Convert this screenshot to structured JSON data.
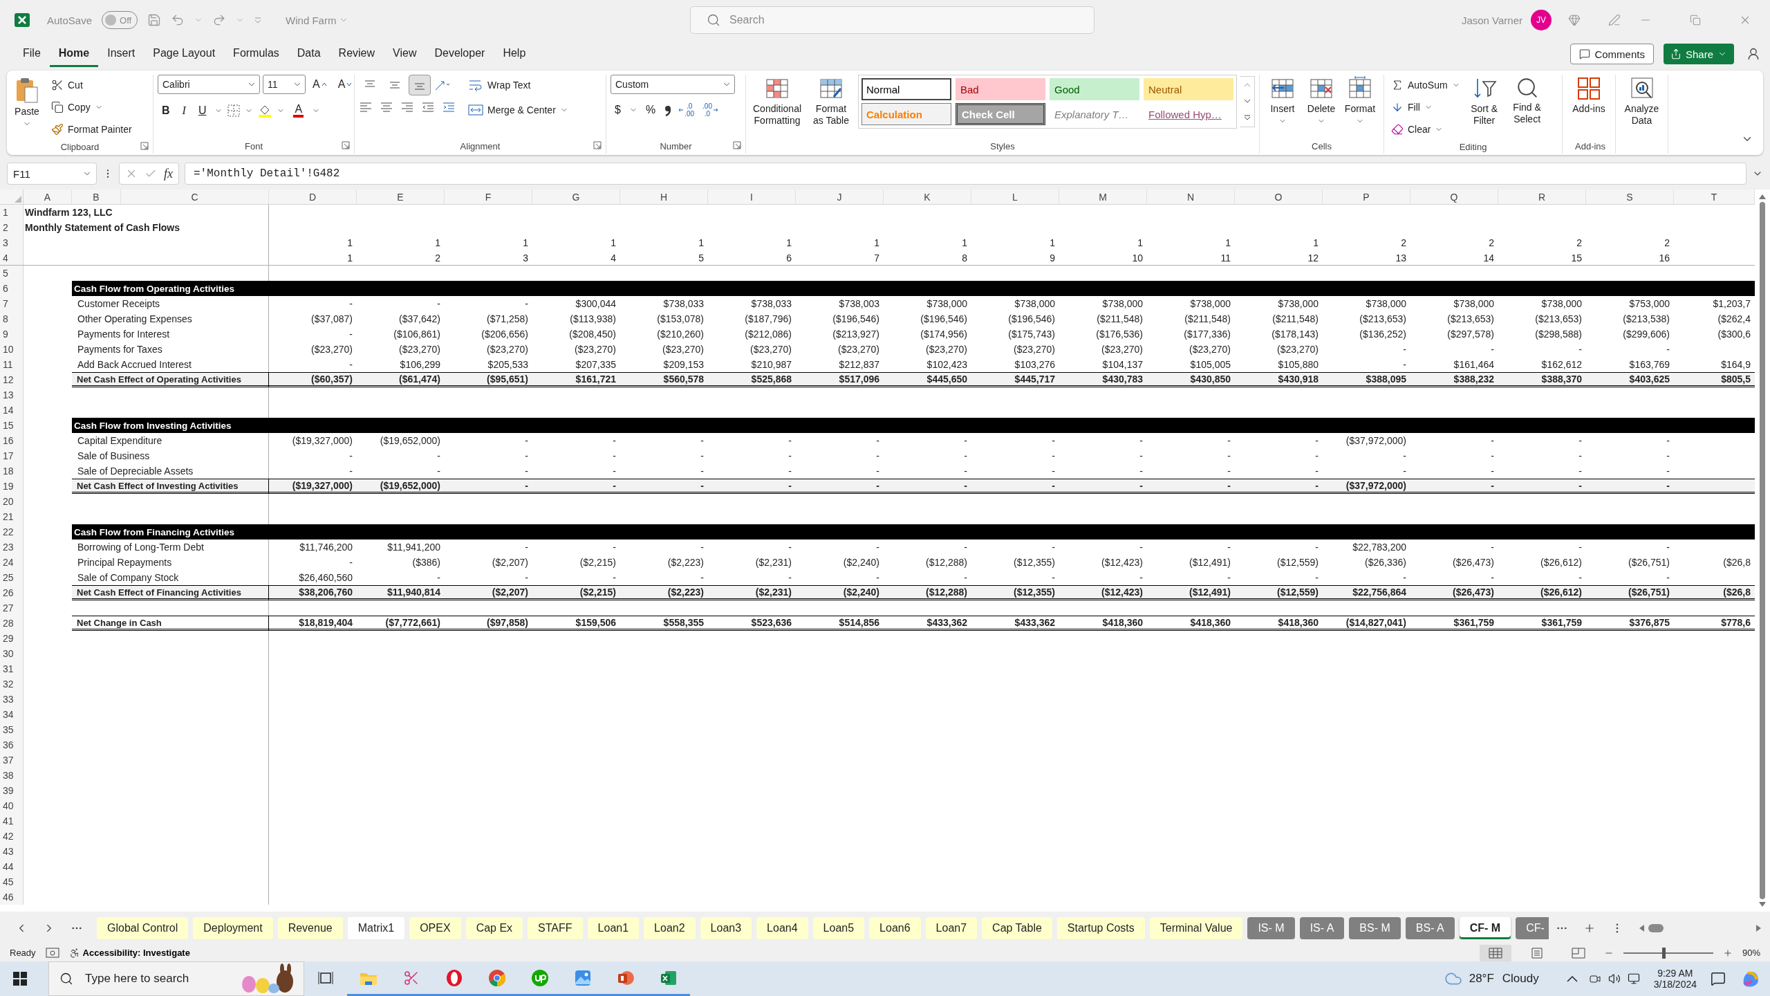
{
  "title_bar": {
    "autosave": "AutoSave",
    "autosave_on": false,
    "autosave_state": "Off",
    "file_name": "Wind Farm",
    "search": {
      "placeholder": "Search"
    },
    "user": "Jason Varner",
    "initials": "JV"
  },
  "menu_tabs": [
    {
      "label": "File",
      "selected": false
    },
    {
      "label": "Home",
      "selected": true
    },
    {
      "label": "Insert",
      "selected": false
    },
    {
      "label": "Page Layout",
      "selected": false
    },
    {
      "label": "Formulas",
      "selected": false
    },
    {
      "label": "Data",
      "selected": false
    },
    {
      "label": "Review",
      "selected": false
    },
    {
      "label": "View",
      "selected": false
    },
    {
      "label": "Developer",
      "selected": false
    },
    {
      "label": "Help",
      "selected": false
    }
  ],
  "header_actions": {
    "comments": "Comments",
    "share": "Share"
  },
  "ribbon": {
    "clipboard": {
      "label": "Clipboard",
      "paste": "Paste",
      "cut": "Cut",
      "copy": "Copy",
      "format_painter": "Format Painter"
    },
    "font": {
      "label": "Font",
      "name": "Calibri",
      "size": "11",
      "grow": "A",
      "shrink": "A",
      "bold": "B",
      "italic": "I",
      "underline": "U",
      "font_color": "A"
    },
    "alignment": {
      "label": "Alignment",
      "vertical_alignment": [
        {
          "selected": false
        },
        {
          "selected": false
        },
        {
          "selected": true
        }
      ],
      "wrap_text": "Wrap Text",
      "merge_center": "Merge & Center"
    },
    "number": {
      "label": "Number",
      "format": "Custom",
      "currency": "$",
      "percent": "%",
      "increase_decimal": [
        ".0",
        ".00"
      ],
      "decrease_decimal": [
        ".00",
        ".0"
      ]
    },
    "styles": {
      "label": "Styles",
      "conditional_formatting": "Conditional Formatting",
      "format_as_table": "Format as Table",
      "cell_styles": [
        {
          "label": "Normal",
          "kind": "normal",
          "selected": true
        },
        {
          "label": "Bad",
          "kind": "bad",
          "selected": false
        },
        {
          "label": "Good",
          "kind": "good",
          "selected": false
        },
        {
          "label": "Neutral",
          "kind": "neutral",
          "selected": false
        },
        {
          "label": "Calculation",
          "kind": "calculation",
          "selected": false
        },
        {
          "label": "Check Cell",
          "kind": "check",
          "selected": false
        },
        {
          "label": "Explanatory T…",
          "kind": "explanatory",
          "selected": false
        },
        {
          "label": "Followed Hyp…",
          "kind": "hyperlink",
          "selected": false
        }
      ]
    },
    "cells": {
      "label": "Cells",
      "buttons": [
        "Insert",
        "Delete",
        "Format"
      ]
    },
    "editing": {
      "label": "Editing",
      "autosum": "AutoSum",
      "fill": "Fill",
      "clear": "Clear",
      "sort_filter": "Sort & Filter",
      "find_select": "Find & Select"
    },
    "add_ins": {
      "label": "Add-ins",
      "button": "Add-ins"
    },
    "analyze": {
      "button": "Analyze Data"
    }
  },
  "formula_bar": {
    "name_box": "F11",
    "fx": "fx",
    "formula": "='Monthly Detail'!G482"
  },
  "sheet": {
    "columns": [
      "A",
      "B",
      "C",
      "D",
      "E",
      "F",
      "G",
      "H",
      "I",
      "J",
      "K",
      "L",
      "M",
      "N",
      "O",
      "P",
      "Q",
      "R",
      "S",
      "T"
    ],
    "rows": [
      {
        "number": "1",
        "kind": "title",
        "text": "Windfarm 123, LLC"
      },
      {
        "number": "2",
        "kind": "title",
        "text": "Monthly Statement of Cash Flows"
      },
      {
        "number": "3",
        "kind": "period",
        "values": [
          "1",
          "1",
          "1",
          "1",
          "1",
          "1",
          "1",
          "1",
          "1",
          "1",
          "1",
          "1",
          "2",
          "2",
          "2",
          "2"
        ]
      },
      {
        "number": "4",
        "kind": "period",
        "values": [
          "1",
          "2",
          "3",
          "4",
          "5",
          "6",
          "7",
          "8",
          "9",
          "10",
          "11",
          "12",
          "13",
          "14",
          "15",
          "16"
        ]
      },
      {
        "number": "5",
        "kind": "blank"
      },
      {
        "number": "6",
        "kind": "section",
        "label": "Cash Flow from Operating Activities"
      },
      {
        "number": "7",
        "kind": "item",
        "label": "Customer Receipts",
        "values": [
          "-",
          "-",
          "-",
          "$300,044",
          "$738,033",
          "$738,033",
          "$738,003",
          "$738,000",
          "$738,000",
          "$738,000",
          "$738,000",
          "$738,000",
          "$738,000",
          "$738,000",
          "$738,000",
          "$753,000",
          "$1,203,7"
        ]
      },
      {
        "number": "8",
        "kind": "item",
        "label": "Other Operating Expenses",
        "values": [
          "($37,087)",
          "($37,642)",
          "($71,258)",
          "($113,938)",
          "($153,078)",
          "($187,796)",
          "($196,546)",
          "($196,546)",
          "($196,546)",
          "($211,548)",
          "($211,548)",
          "($211,548)",
          "($213,653)",
          "($213,653)",
          "($213,653)",
          "($213,538)",
          "($262,4"
        ]
      },
      {
        "number": "9",
        "kind": "item",
        "label": "Payments for Interest",
        "values": [
          "-",
          "($106,861)",
          "($206,656)",
          "($208,450)",
          "($210,260)",
          "($212,086)",
          "($213,927)",
          "($174,956)",
          "($175,743)",
          "($176,536)",
          "($177,336)",
          "($178,143)",
          "($136,252)",
          "($297,578)",
          "($298,588)",
          "($299,606)",
          "($300,6"
        ]
      },
      {
        "number": "10",
        "kind": "item",
        "label": "Payments for Taxes",
        "values": [
          "($23,270)",
          "($23,270)",
          "($23,270)",
          "($23,270)",
          "($23,270)",
          "($23,270)",
          "($23,270)",
          "($23,270)",
          "($23,270)",
          "($23,270)",
          "($23,270)",
          "($23,270)",
          "-",
          "-",
          "-",
          "-"
        ]
      },
      {
        "number": "11",
        "kind": "item",
        "label": "Add Back Accrued Interest",
        "values": [
          "-",
          "$106,299",
          "$205,533",
          "$207,335",
          "$209,153",
          "$210,987",
          "$212,837",
          "$102,423",
          "$103,276",
          "$104,137",
          "$105,005",
          "$105,880",
          "-",
          "$161,464",
          "$162,612",
          "$163,769",
          "$164,9"
        ]
      },
      {
        "number": "12",
        "kind": "total",
        "label": "Net Cash Effect of Operating Activities",
        "values": [
          "($60,357)",
          "($61,474)",
          "($95,651)",
          "$161,721",
          "$560,578",
          "$525,868",
          "$517,096",
          "$445,650",
          "$445,717",
          "$430,783",
          "$430,850",
          "$430,918",
          "$388,095",
          "$388,232",
          "$388,370",
          "$403,625",
          "$805,5"
        ]
      },
      {
        "number": "13",
        "kind": "blank"
      },
      {
        "number": "14",
        "kind": "blank"
      },
      {
        "number": "15",
        "kind": "section",
        "label": "Cash Flow from Investing Activities"
      },
      {
        "number": "16",
        "kind": "item",
        "label": "Capital Expenditure",
        "values": [
          "($19,327,000)",
          "($19,652,000)",
          "-",
          "-",
          "-",
          "-",
          "-",
          "-",
          "-",
          "-",
          "-",
          "-",
          "($37,972,000)",
          "-",
          "-",
          "-"
        ]
      },
      {
        "number": "17",
        "kind": "item",
        "label": "Sale of Business",
        "values": [
          "-",
          "-",
          "-",
          "-",
          "-",
          "-",
          "-",
          "-",
          "-",
          "-",
          "-",
          "-",
          "-",
          "-",
          "-",
          "-"
        ]
      },
      {
        "number": "18",
        "kind": "item",
        "label": "Sale of Depreciable Assets",
        "values": [
          "-",
          "-",
          "-",
          "-",
          "-",
          "-",
          "-",
          "-",
          "-",
          "-",
          "-",
          "-",
          "-",
          "-",
          "-",
          "-"
        ]
      },
      {
        "number": "19",
        "kind": "total",
        "label": "Net Cash Effect of Investing Activities",
        "values": [
          "($19,327,000)",
          "($19,652,000)",
          "-",
          "-",
          "-",
          "-",
          "-",
          "-",
          "-",
          "-",
          "-",
          "-",
          "($37,972,000)",
          "-",
          "-",
          "-"
        ]
      },
      {
        "number": "20",
        "kind": "blank"
      },
      {
        "number": "21",
        "kind": "blank"
      },
      {
        "number": "22",
        "kind": "section",
        "label": "Cash Flow from Financing Activities"
      },
      {
        "number": "23",
        "kind": "item",
        "label": "Borrowing of Long-Term Debt",
        "values": [
          "$11,746,200",
          "$11,941,200",
          "-",
          "-",
          "-",
          "-",
          "-",
          "-",
          "-",
          "-",
          "-",
          "-",
          "$22,783,200",
          "-",
          "-",
          "-"
        ]
      },
      {
        "number": "24",
        "kind": "item",
        "label": "Principal Repayments",
        "values": [
          "-",
          "($386)",
          "($2,207)",
          "($2,215)",
          "($2,223)",
          "($2,231)",
          "($2,240)",
          "($12,288)",
          "($12,355)",
          "($12,423)",
          "($12,491)",
          "($12,559)",
          "($26,336)",
          "($26,473)",
          "($26,612)",
          "($26,751)",
          "($26,8"
        ]
      },
      {
        "number": "25",
        "kind": "item",
        "label": "Sale of Company Stock",
        "values": [
          "$26,460,560",
          "-",
          "-",
          "-",
          "-",
          "-",
          "-",
          "-",
          "-",
          "-",
          "-",
          "-",
          "-",
          "-",
          "-",
          "-"
        ]
      },
      {
        "number": "26",
        "kind": "total",
        "label": "Net Cash Effect of Financing Activities",
        "values": [
          "$38,206,760",
          "$11,940,814",
          "($2,207)",
          "($2,215)",
          "($2,223)",
          "($2,231)",
          "($2,240)",
          "($12,288)",
          "($12,355)",
          "($12,423)",
          "($12,491)",
          "($12,559)",
          "$22,756,864",
          "($26,473)",
          "($26,612)",
          "($26,751)",
          "($26,8"
        ]
      },
      {
        "number": "27",
        "kind": "blank"
      },
      {
        "number": "28",
        "kind": "grand_total",
        "label": "Net Change in Cash",
        "values": [
          "$18,819,404",
          "($7,772,661)",
          "($97,858)",
          "$159,506",
          "$558,355",
          "$523,636",
          "$514,856",
          "$433,362",
          "$433,362",
          "$418,360",
          "$418,360",
          "$418,360",
          "($14,827,041)",
          "$361,759",
          "$361,759",
          "$376,875",
          "$778,6"
        ]
      },
      {
        "number": "29",
        "kind": "blank"
      },
      {
        "number": "30",
        "kind": "blank"
      },
      {
        "number": "31",
        "kind": "blank"
      },
      {
        "number": "32",
        "kind": "blank"
      },
      {
        "number": "33",
        "kind": "blank"
      },
      {
        "number": "34",
        "kind": "blank"
      },
      {
        "number": "35",
        "kind": "blank"
      },
      {
        "number": "36",
        "kind": "blank"
      },
      {
        "number": "37",
        "kind": "blank"
      },
      {
        "number": "38",
        "kind": "blank"
      },
      {
        "number": "39",
        "kind": "blank"
      },
      {
        "number": "40",
        "kind": "blank"
      },
      {
        "number": "41",
        "kind": "blank"
      },
      {
        "number": "42",
        "kind": "blank"
      },
      {
        "number": "43",
        "kind": "blank"
      },
      {
        "number": "44",
        "kind": "blank"
      },
      {
        "number": "45",
        "kind": "blank"
      },
      {
        "number": "46",
        "kind": "blank"
      }
    ]
  },
  "sheet_tabs": [
    {
      "label": "Global Control",
      "color": "#ffffcc",
      "selected": false
    },
    {
      "label": "Deployment",
      "color": "#ffffcc",
      "selected": false
    },
    {
      "label": "Revenue",
      "color": "#ffffcc",
      "selected": false
    },
    {
      "label": "Matrix1",
      "color": "#ffffff",
      "selected": false
    },
    {
      "label": "OPEX",
      "color": "#ffffcc",
      "selected": false
    },
    {
      "label": "Cap Ex",
      "color": "#ffffcc",
      "selected": false
    },
    {
      "label": "STAFF",
      "color": "#ffffcc",
      "selected": false
    },
    {
      "label": "Loan1",
      "color": "#ffffcc",
      "selected": false
    },
    {
      "label": "Loan2",
      "color": "#ffffcc",
      "selected": false
    },
    {
      "label": "Loan3",
      "color": "#ffffcc",
      "selected": false
    },
    {
      "label": "Loan4",
      "color": "#ffffcc",
      "selected": false
    },
    {
      "label": "Loan5",
      "color": "#ffffcc",
      "selected": false
    },
    {
      "label": "Loan6",
      "color": "#ffffcc",
      "selected": false
    },
    {
      "label": "Loan7",
      "color": "#ffffcc",
      "selected": false
    },
    {
      "label": "Cap Table",
      "color": "#ffffcc",
      "selected": false
    },
    {
      "label": "Startup Costs",
      "color": "#ffffcc",
      "selected": false
    },
    {
      "label": "Terminal Value",
      "color": "#ffffcc",
      "selected": false
    },
    {
      "label": "IS- M",
      "color": "#808080",
      "selected": false
    },
    {
      "label": "IS- A",
      "color": "#808080",
      "selected": false
    },
    {
      "label": "BS- M",
      "color": "#808080",
      "selected": false
    },
    {
      "label": "BS- A",
      "color": "#808080",
      "selected": false
    },
    {
      "label": "CF- M",
      "selected": true
    },
    {
      "label": "CF-",
      "color": "#808080",
      "selected": false
    }
  ],
  "status_bar": {
    "ready": "Ready",
    "accessibility": "Accessibility: Investigate",
    "views": [
      {
        "selected": true
      },
      {
        "selected": false
      },
      {
        "selected": false
      }
    ],
    "zoom_slider": {
      "level": 0.45
    },
    "zoom": "90%"
  },
  "taskbar": {
    "search": {
      "placeholder": "Type here to search"
    },
    "temperature": "28°F",
    "weather": "Cloudy",
    "time": "9:29 AM",
    "date": "3/18/2024"
  }
}
